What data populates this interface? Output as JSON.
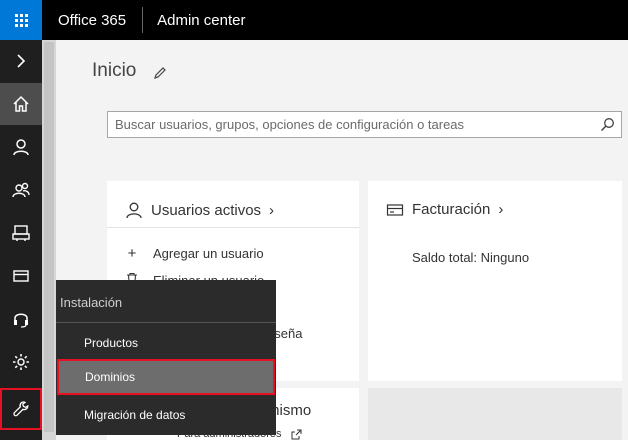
{
  "topbar": {
    "brand": "Office 365",
    "app_title": "Admin center"
  },
  "rail": {
    "items": [
      {
        "icon": "chevron-right-icon"
      },
      {
        "icon": "home-icon"
      },
      {
        "icon": "user-icon"
      },
      {
        "icon": "groups-icon"
      },
      {
        "icon": "resources-icon"
      },
      {
        "icon": "billing-icon"
      },
      {
        "icon": "support-icon"
      },
      {
        "icon": "settings-gear-icon"
      },
      {
        "icon": "wrench-icon"
      }
    ],
    "accent": "#0078d7",
    "highlight": "#e81123"
  },
  "main": {
    "page_title": "Inicio",
    "search_placeholder": "Buscar usuarios, grupos, opciones de configuración o tareas"
  },
  "cards": {
    "users": {
      "title": "Usuarios activos",
      "actions": [
        {
          "label": "Agregar un usuario",
          "icon": "plus-icon"
        },
        {
          "label": "Eliminar un usuario",
          "icon": "trash-icon"
        },
        {
          "label": "aseña",
          "icon": "key-icon"
        }
      ]
    },
    "billing": {
      "title": "Facturación",
      "text": "Saldo total: Ninguno"
    },
    "bottom_left": {
      "title": "mismo",
      "subtitle": "Para administradores"
    }
  },
  "flyout": {
    "title": "Instalación",
    "items": [
      {
        "label": "Productos"
      },
      {
        "label": "Dominios",
        "selected": true
      },
      {
        "label": "Migración de datos"
      }
    ]
  }
}
